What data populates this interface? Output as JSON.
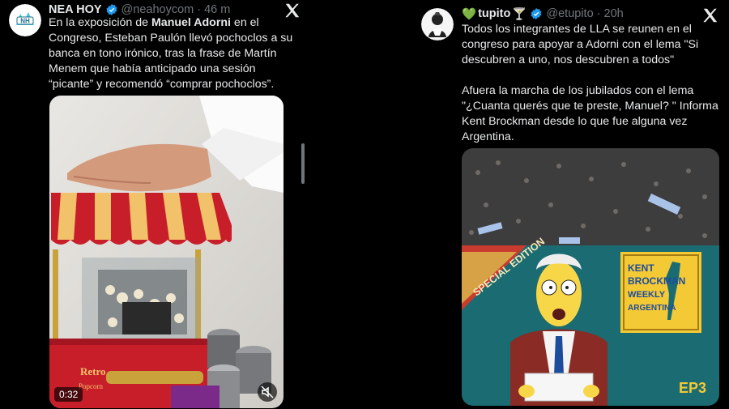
{
  "tweet1": {
    "display_name": "NEA HOY",
    "handle": "@neahoycom",
    "time": "· 46 m",
    "avatar_text": "NH",
    "text_parts": [
      "En la exposición de ",
      "Manuel Adorni",
      " en el Congreso, Esteban Paulón llevó pochoclos a su banca en tono irónico, tras la frase de Martín Menem que había anticipado una sesión “picante” y recomendó “comprar pochoclos”."
    ],
    "video": {
      "duration": "0:32",
      "sign_text": "Retro",
      "machine_brand": "Popcorn"
    }
  },
  "tweet2": {
    "display_name": "tupito",
    "name_prefix_emoji": "💚",
    "name_suffix_emoji": "🍸",
    "handle": "@etupito",
    "time": "· 20h",
    "paragraph1": "Todos los integrantes de LLA se reunen en el congreso para apoyar a Adorni con el lema \"Si descubren a uno, nos descubren a todos\"",
    "paragraph2": "Afuera la marcha de los jubilados con el lema \"¿Cuanta querés que te preste, Manuel? \" Informa Kent Brockman desde lo que fue alguna vez Argentina.",
    "image": {
      "banner": "SPECIAL EDITION",
      "sign_line1": "KENT",
      "sign_line2": "BROCKMAN",
      "sign_line3": "WEEKLY",
      "sign_line4": "ARGENTINA",
      "episode": "EP3"
    }
  },
  "colors": {
    "background": "#000000",
    "text": "#e7e9ea",
    "muted": "#71767b",
    "verified": "#1d9bf0"
  }
}
